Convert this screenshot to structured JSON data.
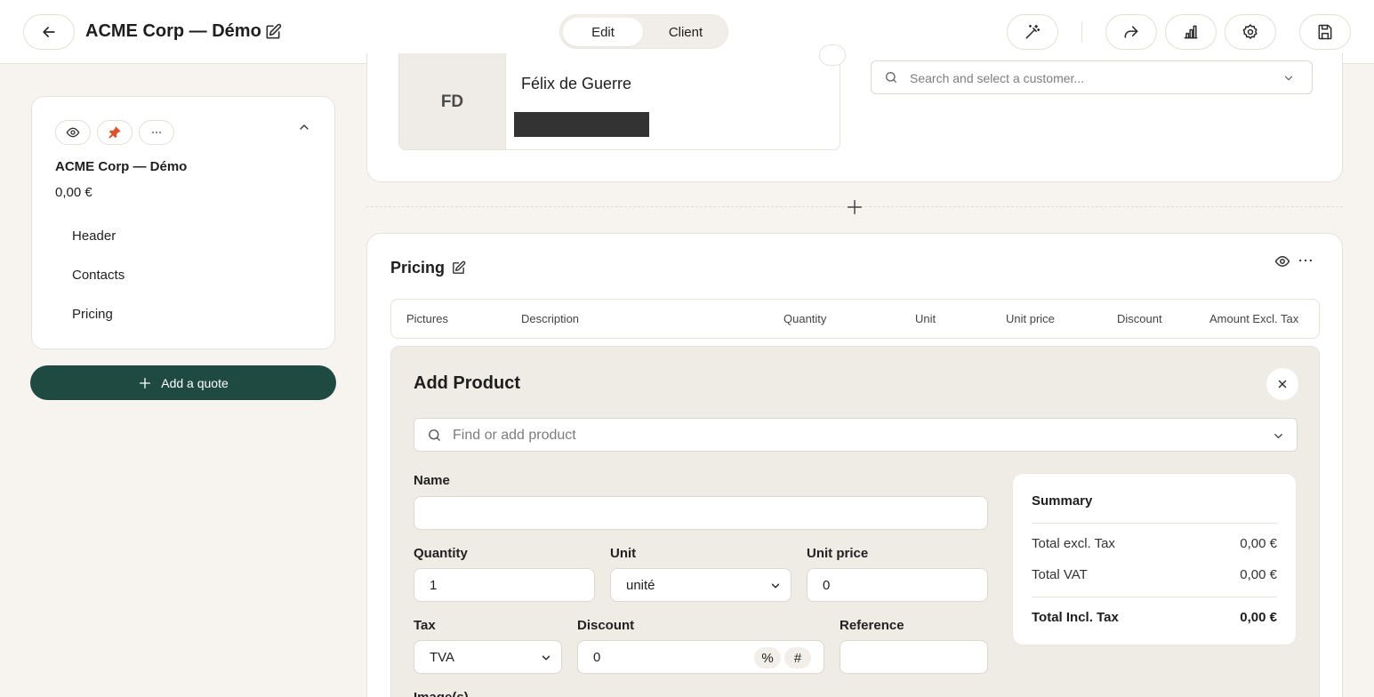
{
  "header": {
    "title": "ACME Corp — Démo",
    "tabs": [
      {
        "label": "Edit",
        "active": false
      },
      {
        "label": "Client",
        "active": true
      }
    ]
  },
  "sidebar": {
    "name": "ACME Corp — Démo",
    "amount": "0,00 €",
    "nav": [
      "Header",
      "Contacts",
      "Pricing"
    ],
    "add_quote_label": "Add a quote"
  },
  "contacts": {
    "avatar_initials": "FD",
    "contact_name": "Félix de Guerre",
    "customer_search_placeholder": "Search and select a customer..."
  },
  "pricing": {
    "title": "Pricing",
    "columns": [
      "Pictures",
      "Description",
      "Quantity",
      "Unit",
      "Unit price",
      "Discount",
      "Amount Excl. Tax"
    ]
  },
  "add_product": {
    "title": "Add Product",
    "search_placeholder": "Find or add product",
    "fields": {
      "name_label": "Name",
      "name_value": "",
      "quantity_label": "Quantity",
      "quantity_value": "1",
      "unit_label": "Unit",
      "unit_value": "unité",
      "unit_price_label": "Unit price",
      "unit_price_value": "0",
      "tax_label": "Tax",
      "tax_value": "TVA",
      "discount_label": "Discount",
      "discount_value": "0",
      "discount_percent": "%",
      "discount_fixed": "#",
      "reference_label": "Reference",
      "reference_value": "",
      "images_label": "Image(s)"
    },
    "summary": {
      "title": "Summary",
      "rows": [
        {
          "label": "Total excl. Tax",
          "value": "0,00 €"
        },
        {
          "label": "Total VAT",
          "value": "0,00 €"
        }
      ],
      "total": {
        "label": "Total Incl. Tax",
        "value": "0,00 €"
      }
    }
  },
  "colors": {
    "accent": "#1f4a42",
    "background": "#f7f4ef",
    "pin": "#d9532b"
  }
}
